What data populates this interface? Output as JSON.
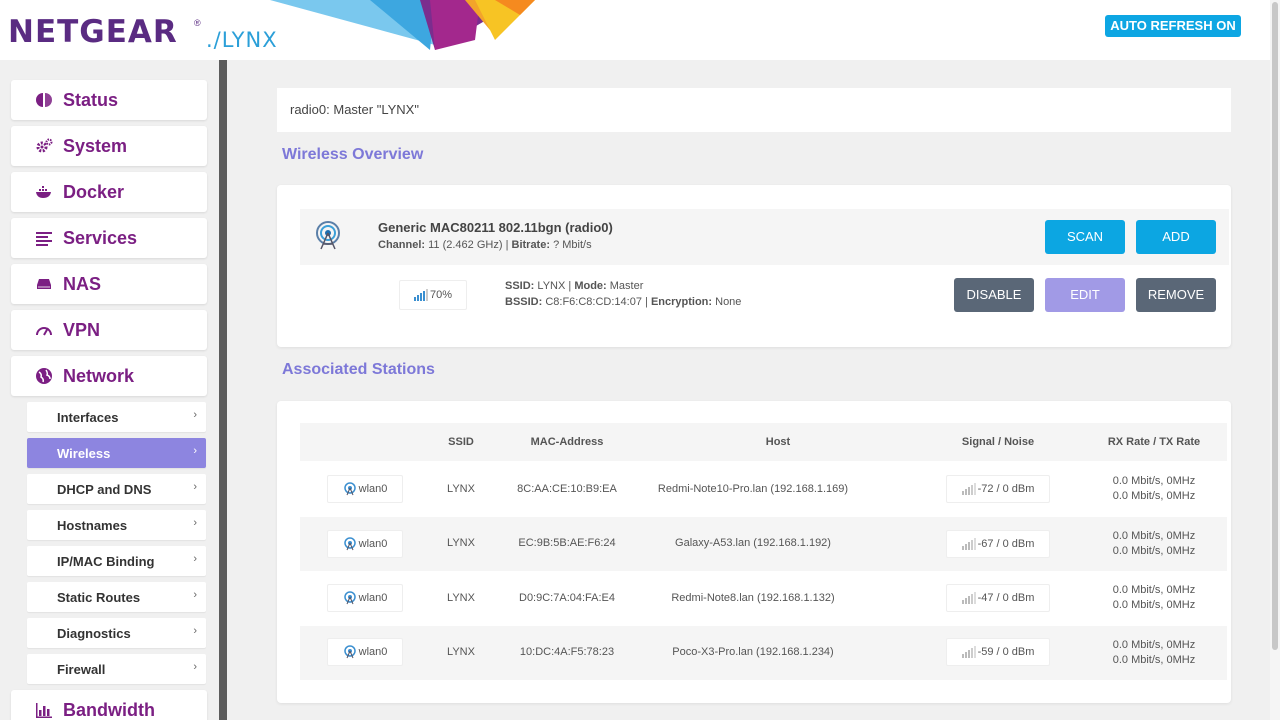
{
  "header": {
    "logo": "NETGEAR",
    "logo_reg": "®",
    "logo_sub": "./LYNX",
    "auto_refresh": "AUTO REFRESH ON"
  },
  "sidebar": {
    "menu": [
      {
        "label": "Status",
        "icon": "pie-chart-icon"
      },
      {
        "label": "System",
        "icon": "gears-icon"
      },
      {
        "label": "Docker",
        "icon": "docker-icon"
      },
      {
        "label": "Services",
        "icon": "list-icon"
      },
      {
        "label": "NAS",
        "icon": "drive-icon"
      },
      {
        "label": "VPN",
        "icon": "speedometer-icon"
      },
      {
        "label": "Network",
        "icon": "globe-icon"
      }
    ],
    "network_submenu": [
      {
        "label": "Interfaces",
        "active": false
      },
      {
        "label": "Wireless",
        "active": true
      },
      {
        "label": "DHCP and DNS",
        "active": false
      },
      {
        "label": "Hostnames",
        "active": false
      },
      {
        "label": "IP/MAC Binding",
        "active": false
      },
      {
        "label": "Static Routes",
        "active": false
      },
      {
        "label": "Diagnostics",
        "active": false
      },
      {
        "label": "Firewall",
        "active": false
      }
    ],
    "bandwidth": {
      "label": "Bandwidth",
      "icon": "bar-chart-icon"
    },
    "chevron": "›"
  },
  "main": {
    "radio_bar": "radio0: Master \"LYNX\"",
    "wireless_overview_title": "Wireless Overview",
    "device": {
      "name": "Generic MAC80211 802.11bgn (radio0)",
      "channel_label": "Channel:",
      "channel_value": "11 (2.462 GHz)",
      "bitrate_label": "Bitrate:",
      "bitrate_value": "? Mbit/s",
      "scan": "SCAN",
      "add": "ADD"
    },
    "network": {
      "signal": "70%",
      "ssid_label": "SSID:",
      "ssid_value": "LYNX",
      "mode_label": "Mode:",
      "mode_value": "Master",
      "bssid_label": "BSSID:",
      "bssid_value": "C8:F6:C8:CD:14:07",
      "encryption_label": "Encryption:",
      "encryption_value": "None",
      "sep": "|",
      "disable": "DISABLE",
      "edit": "EDIT",
      "remove": "REMOVE"
    },
    "stations_title": "Associated Stations",
    "table": {
      "headers": [
        "SSID",
        "MAC-Address",
        "Host",
        "Signal / Noise",
        "RX Rate / TX Rate"
      ],
      "rows": [
        {
          "iface": "wlan0",
          "ssid": "LYNX",
          "mac": "8C:AA:CE:10:B9:EA",
          "host": "Redmi-Note10-Pro.lan (192.168.1.169)",
          "signal": "-72 / 0 dBm",
          "rx": "0.0 Mbit/s, 0MHz",
          "tx": "0.0 Mbit/s, 0MHz"
        },
        {
          "iface": "wlan0",
          "ssid": "LYNX",
          "mac": "EC:9B:5B:AE:F6:24",
          "host": "Galaxy-A53.lan (192.168.1.192)",
          "signal": "-67 / 0 dBm",
          "rx": "0.0 Mbit/s, 0MHz",
          "tx": "0.0 Mbit/s, 0MHz"
        },
        {
          "iface": "wlan0",
          "ssid": "LYNX",
          "mac": "D0:9C:7A:04:FA:E4",
          "host": "Redmi-Note8.lan (192.168.1.132)",
          "signal": "-47 / 0 dBm",
          "rx": "0.0 Mbit/s, 0MHz",
          "tx": "0.0 Mbit/s, 0MHz"
        },
        {
          "iface": "wlan0",
          "ssid": "LYNX",
          "mac": "10:DC:4A:F5:78:23",
          "host": "Poco-X3-Pro.lan (192.168.1.234)",
          "signal": "-59 / 0 dBm",
          "rx": "0.0 Mbit/s, 0MHz",
          "tx": "0.0 Mbit/s, 0MHz"
        }
      ]
    }
  },
  "colors": {
    "brand_purple": "#7b1f83",
    "accent_blue": "#0ca6e2",
    "accent_lavender": "#8d85e0",
    "slate": "#5a6777"
  }
}
